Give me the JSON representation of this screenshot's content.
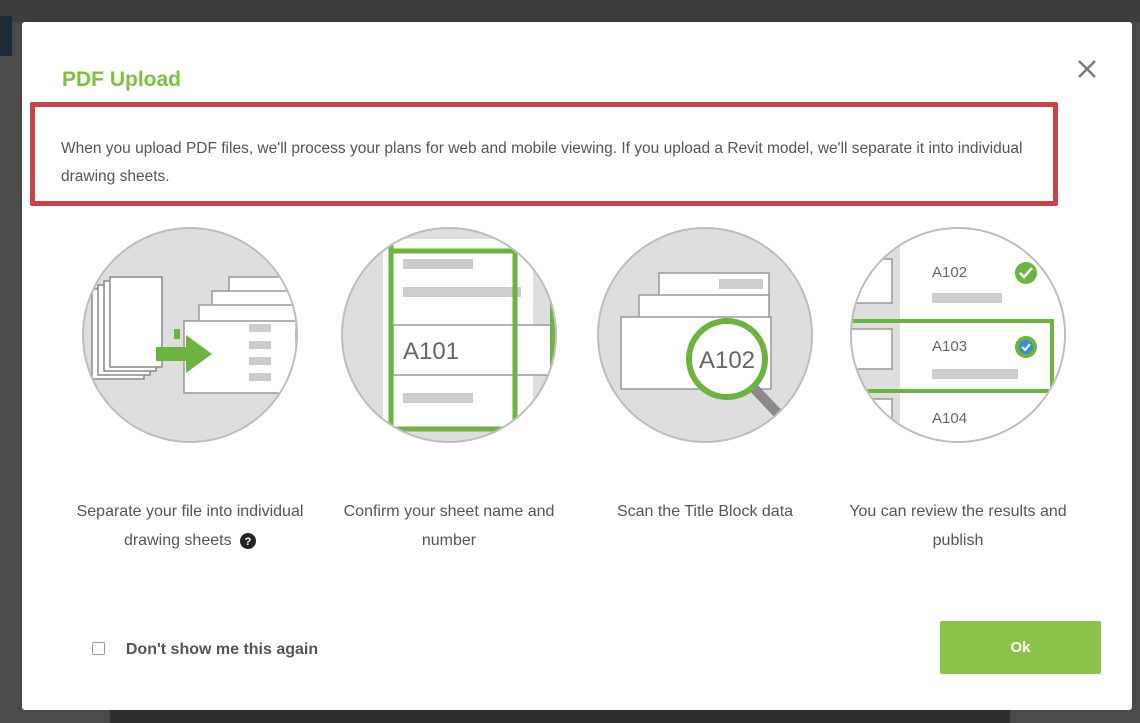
{
  "modal": {
    "title": "PDF Upload",
    "description": "When you upload PDF files, we'll process your plans for web and mobile viewing. If you upload a Revit model, we'll separate it into individual drawing sheets."
  },
  "steps": [
    {
      "label": "Separate your file into individual drawing sheets",
      "icon": "separate-sheets-illustration"
    },
    {
      "label": "Confirm your sheet name and number",
      "icon": "confirm-sheet-illustration",
      "sheet": "A101"
    },
    {
      "label": "Scan the Title Block data",
      "icon": "scan-title-block-illustration",
      "sheet": "A102"
    },
    {
      "label": "You can review the results and publish",
      "icon": "review-publish-illustration",
      "sheets": [
        "A102",
        "A103",
        "A104"
      ]
    }
  ],
  "footer": {
    "dont_show_label": "Don't show me this again",
    "ok_label": "Ok"
  },
  "colors": {
    "accent": "#7cc23f",
    "button": "#8bc34a",
    "highlight_border": "#c7444a"
  }
}
